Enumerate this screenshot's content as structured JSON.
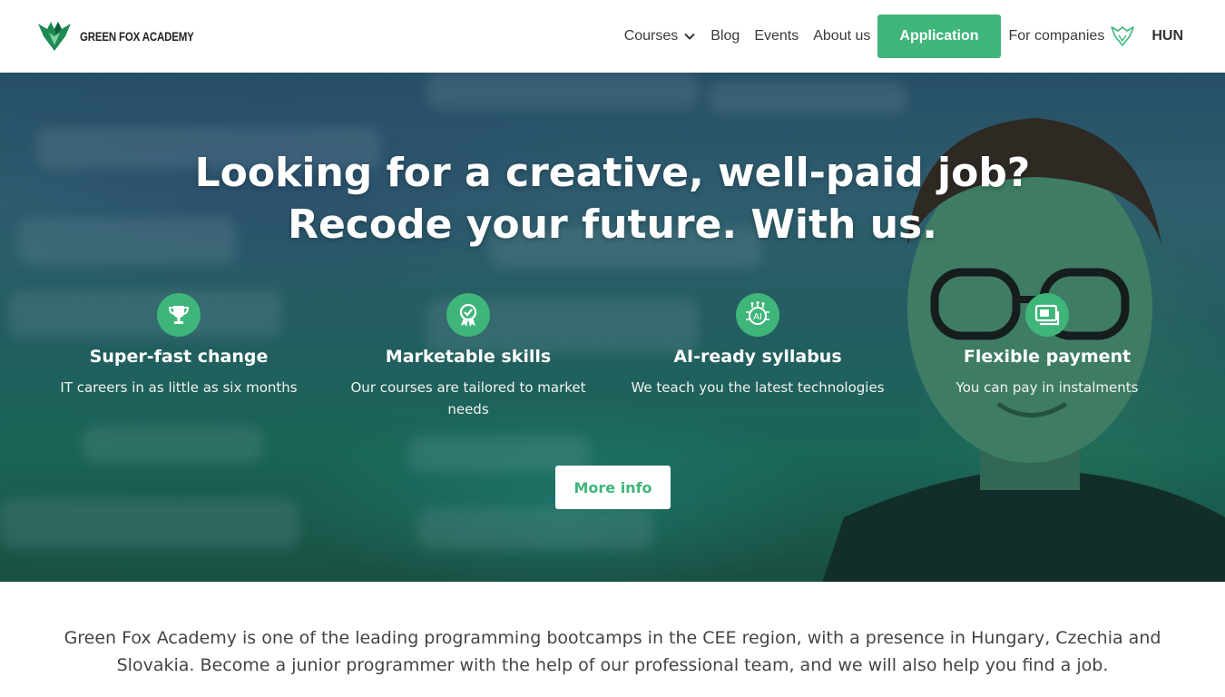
{
  "header": {
    "logo_text": "GREEN FOX ACADEMY",
    "nav": {
      "courses": "Courses",
      "blog": "Blog",
      "events": "Events",
      "about": "About us",
      "application": "Application",
      "companies": "For companies",
      "language": "HUN"
    }
  },
  "hero": {
    "title_line1": "Looking for a creative, well-paid job?",
    "title_line2": "Recode your future. With us.",
    "features": [
      {
        "icon": "trophy-icon",
        "title": "Super-fast change",
        "desc": "IT careers in as little as six months"
      },
      {
        "icon": "award-icon",
        "title": "Marketable skills",
        "desc": "Our courses are tailored to market needs"
      },
      {
        "icon": "ai-chip-icon",
        "title": "AI-ready syllabus",
        "desc": "We teach you the latest technologies"
      },
      {
        "icon": "payment-icon",
        "title": "Flexible payment",
        "desc": "You can pay in instalments"
      }
    ],
    "more_info": "More info"
  },
  "intro": {
    "text": "Green Fox Academy is one of the leading programming bootcamps in the CEE region, with a presence in Hungary, Czechia and Slovakia. Become a junior programmer with the help of our professional team, and we will also help you find a job."
  },
  "colors": {
    "brand_green": "#3fb57a",
    "text_dark": "#333333"
  }
}
